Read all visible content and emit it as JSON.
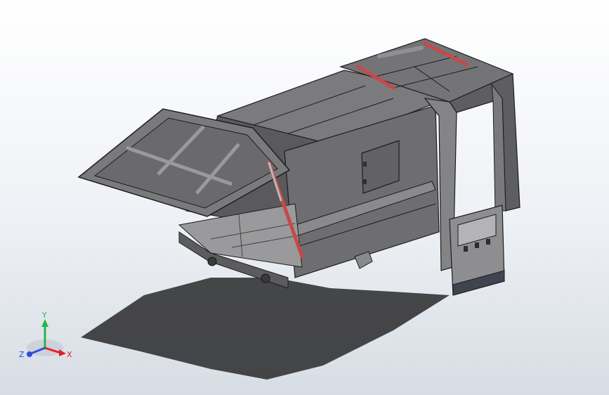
{
  "triad": {
    "x_label": "X",
    "y_label": "Y",
    "z_label": "Z",
    "x_color": "#e0202a",
    "y_color": "#2bb24c",
    "z_color": "#2b4fd8"
  },
  "model": {
    "body_color": "#6d6d6f",
    "dark_color": "#4a4a4c",
    "light_color": "#8a8a8c",
    "edge_color": "#1d1d1f",
    "cylinder_color": "#c8484a"
  }
}
